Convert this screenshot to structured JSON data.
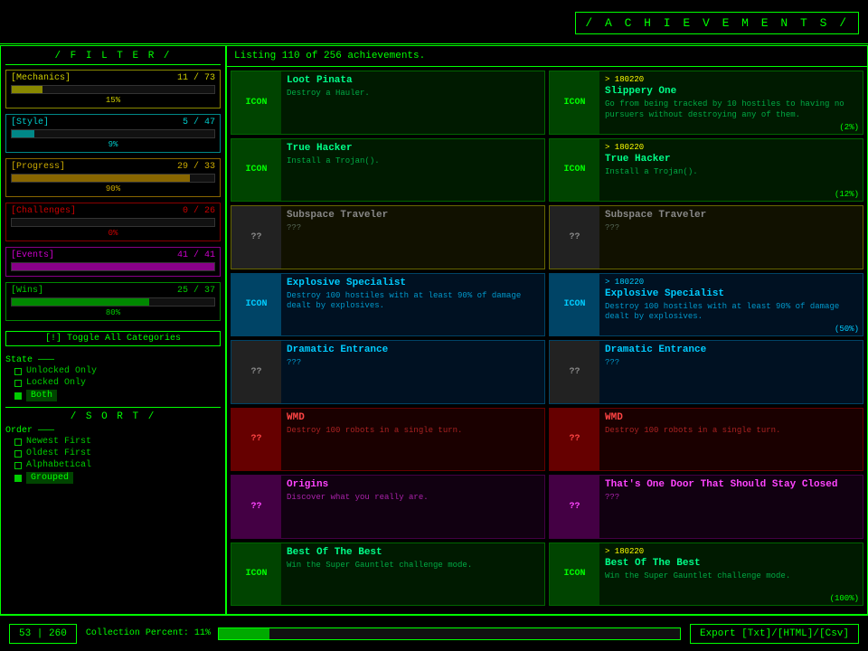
{
  "header": {
    "title": "/ A C H I E V E M E N T S /"
  },
  "listing": {
    "text": "Listing 110 of 256 achievements."
  },
  "filter": {
    "title": "/ F I L T E R /",
    "categories": [
      {
        "id": "mechanics",
        "label": "[Mechanics]",
        "current": 11,
        "total": 73,
        "percent": 15,
        "pct_label": "15%",
        "class": "mechanics"
      },
      {
        "id": "style",
        "label": "[Style]",
        "current": 5,
        "total": 47,
        "percent": 11,
        "pct_label": "9%",
        "class": "style"
      },
      {
        "id": "progress",
        "label": "[Progress]",
        "current": 29,
        "total": 33,
        "percent": 88,
        "pct_label": "90%",
        "class": "progress"
      },
      {
        "id": "challenges",
        "label": "[Challenges]",
        "current": 0,
        "total": 26,
        "percent": 0,
        "pct_label": "0%",
        "class": "challenges"
      },
      {
        "id": "events",
        "label": "[Events]",
        "current": 41,
        "total": 41,
        "percent": 100,
        "pct_label": "",
        "class": "events"
      },
      {
        "id": "wins",
        "label": "[Wins]",
        "current": 25,
        "total": 37,
        "percent": 68,
        "pct_label": "80%",
        "class": "wins"
      }
    ],
    "toggle_btn": "[!] Toggle All Categories",
    "state_label": "State",
    "state_options": [
      "Unlocked Only",
      "Locked Only",
      "Both"
    ],
    "state_active": "Both"
  },
  "sort": {
    "title": "/ S O R T /",
    "order_label": "Order",
    "order_options": [
      "Newest First",
      "Oldest First",
      "Alphabetical",
      "Grouped"
    ],
    "order_active": "Grouped"
  },
  "achievements": [
    {
      "id": 1,
      "icon_text": "ICON",
      "icon_class": "green",
      "border_class": "green-border",
      "title": "Loot Pinata",
      "title_class": "green",
      "desc": "Destroy a Hauler.",
      "desc_class": "",
      "score": "",
      "progress": "",
      "col": 0
    },
    {
      "id": 2,
      "icon_text": "ICON",
      "icon_class": "green",
      "border_class": "green-border",
      "title": "Slippery One",
      "title_class": "green",
      "desc": "Go from being tracked by 10 hostiles to having no pursuers without destroying any of them.",
      "desc_class": "",
      "score": "> 180220",
      "score_class": "",
      "progress": "(2%)",
      "col": 1
    },
    {
      "id": 3,
      "icon_text": "ICON",
      "icon_class": "green",
      "border_class": "green-border",
      "title": "True Hacker",
      "title_class": "green",
      "desc": "Install a Trojan().",
      "desc_class": "",
      "score": "",
      "progress": "",
      "col": 0
    },
    {
      "id": 4,
      "icon_text": "ICON",
      "icon_class": "green",
      "border_class": "green-border",
      "title": "True Hacker",
      "title_class": "green",
      "desc": "Install a Trojan().",
      "desc_class": "",
      "score": "> 180220",
      "score_class": "",
      "progress": "(12%)",
      "col": 1
    },
    {
      "id": 5,
      "icon_text": "??",
      "icon_class": "dark",
      "border_class": "yellow-border",
      "title": "Subspace Traveler",
      "title_class": "gray",
      "desc": "???",
      "desc_class": "gray-text",
      "score": "",
      "progress": "",
      "col": 0
    },
    {
      "id": 6,
      "icon_text": "??",
      "icon_class": "dark",
      "border_class": "yellow-border",
      "title": "Subspace Traveler",
      "title_class": "gray",
      "desc": "???",
      "desc_class": "gray-text",
      "score": "",
      "progress": "",
      "col": 1
    },
    {
      "id": 7,
      "icon_text": "ICON",
      "icon_class": "blue",
      "border_class": "blue-border",
      "title": "Explosive Specialist",
      "title_class": "blue",
      "desc": "Destroy 100 hostiles with at least 90% of damage dealt by explosives.",
      "desc_class": "blue-text",
      "score": "",
      "progress": "",
      "col": 0
    },
    {
      "id": 8,
      "icon_text": "ICON",
      "icon_class": "blue",
      "border_class": "blue-border",
      "title": "Explosive Specialist",
      "title_class": "blue",
      "desc": "Destroy 100 hostiles with at least 90% of damage dealt by explosives.",
      "desc_class": "blue-text",
      "score": "> 180220",
      "score_class": "blue",
      "progress": "(50%)",
      "col": 1
    },
    {
      "id": 9,
      "icon_text": "??",
      "icon_class": "dark",
      "border_class": "blue-border",
      "title": "Dramatic Entrance",
      "title_class": "blue",
      "desc": "???",
      "desc_class": "blue-text",
      "score": "",
      "progress": "",
      "col": 0
    },
    {
      "id": 10,
      "icon_text": "??",
      "icon_class": "dark",
      "border_class": "blue-border",
      "title": "Dramatic Entrance",
      "title_class": "blue",
      "desc": "???",
      "desc_class": "blue-text",
      "score": "",
      "progress": "",
      "col": 1
    },
    {
      "id": 11,
      "icon_text": "??",
      "icon_class": "red",
      "border_class": "red-border",
      "title": "WMD",
      "title_class": "red",
      "desc": "Destroy 100 robots in a single turn.",
      "desc_class": "red-text",
      "score": "",
      "progress": "",
      "col": 0
    },
    {
      "id": 12,
      "icon_text": "??",
      "icon_class": "red",
      "border_class": "red-border",
      "title": "WMD",
      "title_class": "red",
      "desc": "Destroy 100 robots in a single turn.",
      "desc_class": "red-text",
      "score": "",
      "progress": "",
      "col": 1
    },
    {
      "id": 13,
      "icon_text": "??",
      "icon_class": "purple",
      "border_class": "purple-border",
      "title": "Origins",
      "title_class": "purple",
      "desc": "Discover what you really are.",
      "desc_class": "purple-text",
      "score": "",
      "progress": "",
      "col": 0
    },
    {
      "id": 14,
      "icon_text": "??",
      "icon_class": "purple",
      "border_class": "purple-border",
      "title": "That's One Door That Should Stay Closed",
      "title_class": "purple",
      "desc": "???",
      "desc_class": "purple-text",
      "score": "",
      "progress": "",
      "col": 1
    },
    {
      "id": 15,
      "icon_text": "ICON",
      "icon_class": "green",
      "border_class": "green-border",
      "title": "Best Of The Best",
      "title_class": "green",
      "desc": "Win the Super Gauntlet challenge mode.",
      "desc_class": "",
      "score": "",
      "progress": "",
      "col": 0
    },
    {
      "id": 16,
      "icon_text": "ICON",
      "icon_class": "green",
      "border_class": "green-border",
      "title": "Best Of The Best",
      "title_class": "green",
      "desc": "Win the Super Gauntlet challenge mode.",
      "desc_class": "",
      "score": "> 180220",
      "score_class": "",
      "progress": "(100%)",
      "col": 1
    }
  ],
  "bottom": {
    "count": "53 | 260",
    "collection_label": "Collection Percent: 11%",
    "collection_pct": 11,
    "export_btn": "Export [Txt]/[HTML]/[Csv]"
  }
}
